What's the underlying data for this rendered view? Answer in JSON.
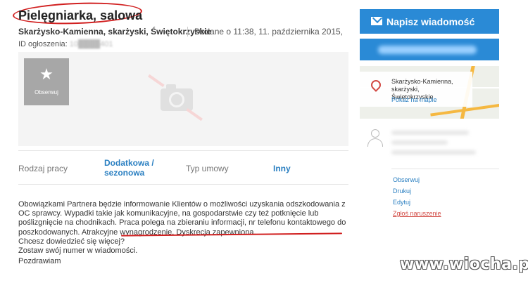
{
  "listing": {
    "title": "Pielęgniarka, salowa",
    "location": "Skarżysko-Kamienna, skarżyski, Świętokrzyskie",
    "added": "Dodane o 11:38, 11. października 2015,",
    "id_label": "ID ogłoszenia:",
    "id_value": "10████401"
  },
  "gallery": {
    "follow_label": "Obserwuj",
    "camera_icon": "camera-icon",
    "star_icon": "star-icon"
  },
  "params": [
    {
      "label": "Rodzaj pracy",
      "value_line1": "Dodatkowa /",
      "value_line2": "sezonowa"
    },
    {
      "label": "Typ umowy",
      "value": "Inny"
    }
  ],
  "description": {
    "lines": [
      "Obowiązkami Partnera będzie informowanie Klientów o możliwości uzyskania odszkodowania z",
      "OC sprawcy. Wypadki takie jak komunikacyjne, na gospodarstwie czy też potknięcie lub",
      "poślizgnięcie na chodnikach. Praca polega na zbieraniu informacji, nr telefonu kontaktowego do",
      "poszkodowanych. Atrakcyjne wynagrodzenie. Dyskrecja zapewniona."
    ],
    "extra": [
      "Chcesz dowiedzieć się więcej?",
      "Zostaw swój numer w wiadomości.",
      "Pozdrawiam"
    ]
  },
  "sidebar": {
    "message_button": "Napisz wiadomość",
    "map": {
      "city_line1": "Skarżysko-Kamienna, skarżyski,",
      "city_line2": "Świętokrzyskie",
      "show_map": "Pokaż na mapie"
    },
    "actions": [
      "Obserwuj",
      "Drukuj",
      "Edytuj",
      "Zgłoś naruszenie"
    ]
  },
  "watermark": "www.wiocha.pl",
  "colors": {
    "accent": "#2a8ad6",
    "link": "#2a7fc1",
    "highlight": "#d12020"
  }
}
